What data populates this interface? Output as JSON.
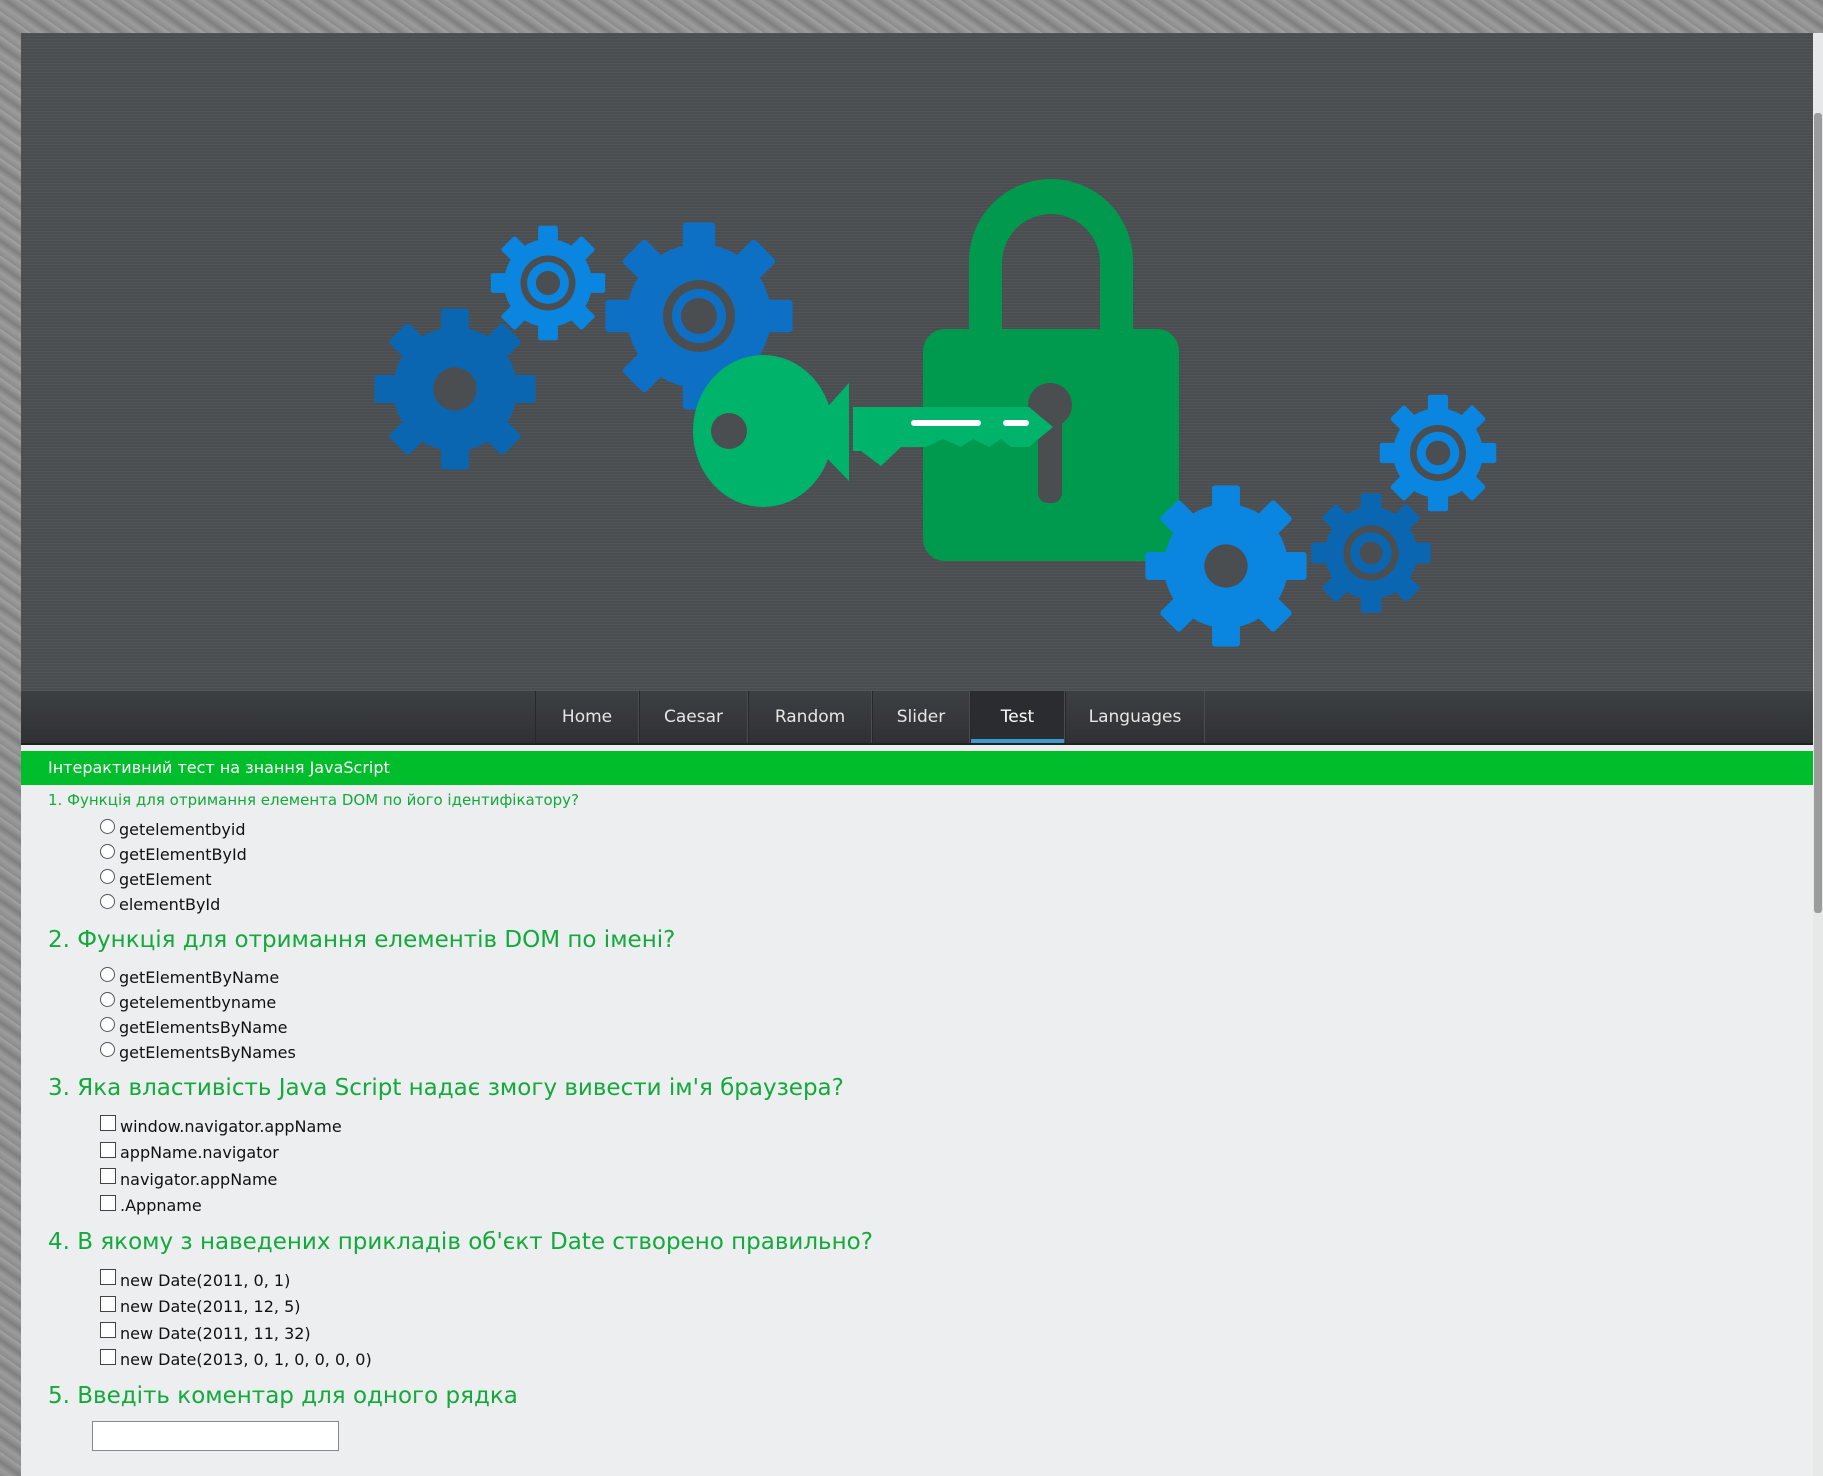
{
  "hero": {
    "image_name": "gears-lock-key-illustration"
  },
  "nav": {
    "items": [
      {
        "label": "Home"
      },
      {
        "label": "Caesar"
      },
      {
        "label": "Random"
      },
      {
        "label": "Slider"
      },
      {
        "label": "Test",
        "active": true
      },
      {
        "label": "Languages"
      }
    ]
  },
  "banner": {
    "text": "Інтерактивний тест на знання JavaScript"
  },
  "questions": [
    {
      "title": "1. Функція для отримання елемента DOM по його ідентифікатору?",
      "type": "radio",
      "options": [
        "getelementbyid",
        "getElementById",
        "getElement",
        "elementById"
      ]
    },
    {
      "title": "2. Функція для отримання елементів DOM по імені?",
      "type": "radio",
      "options": [
        "getElementByName",
        "getelementbyname",
        "getElementsByName",
        "getElementsByNames"
      ]
    },
    {
      "title": "3. Яка властивість Java Script надає змогу вивести ім'я браузера?",
      "type": "checkbox",
      "options": [
        "window.navigator.appName",
        "appName.navigator",
        "navigator.appName",
        ".Appname"
      ]
    },
    {
      "title": "4. В якому з наведених прикладів об'єкт Date створено правильно?",
      "type": "checkbox",
      "options": [
        "new Date(2011, 0, 1)",
        "new Date(2011, 12, 5)",
        "new Date(2011, 11, 32)",
        "new Date(2013, 0, 1, 0, 0, 0, 0)"
      ]
    },
    {
      "title": "5. Введіть коментар для одного рядка",
      "type": "text",
      "value": ""
    }
  ],
  "colors": {
    "banner": "#00bd2c",
    "question_text": "#13a93c",
    "hero_bg": "#4b4e51",
    "gear_blue": "#0a7ad4",
    "lock_green": "#009a4e",
    "key_green": "#00b36b",
    "nav_active_underline": "#3d9ad1"
  }
}
